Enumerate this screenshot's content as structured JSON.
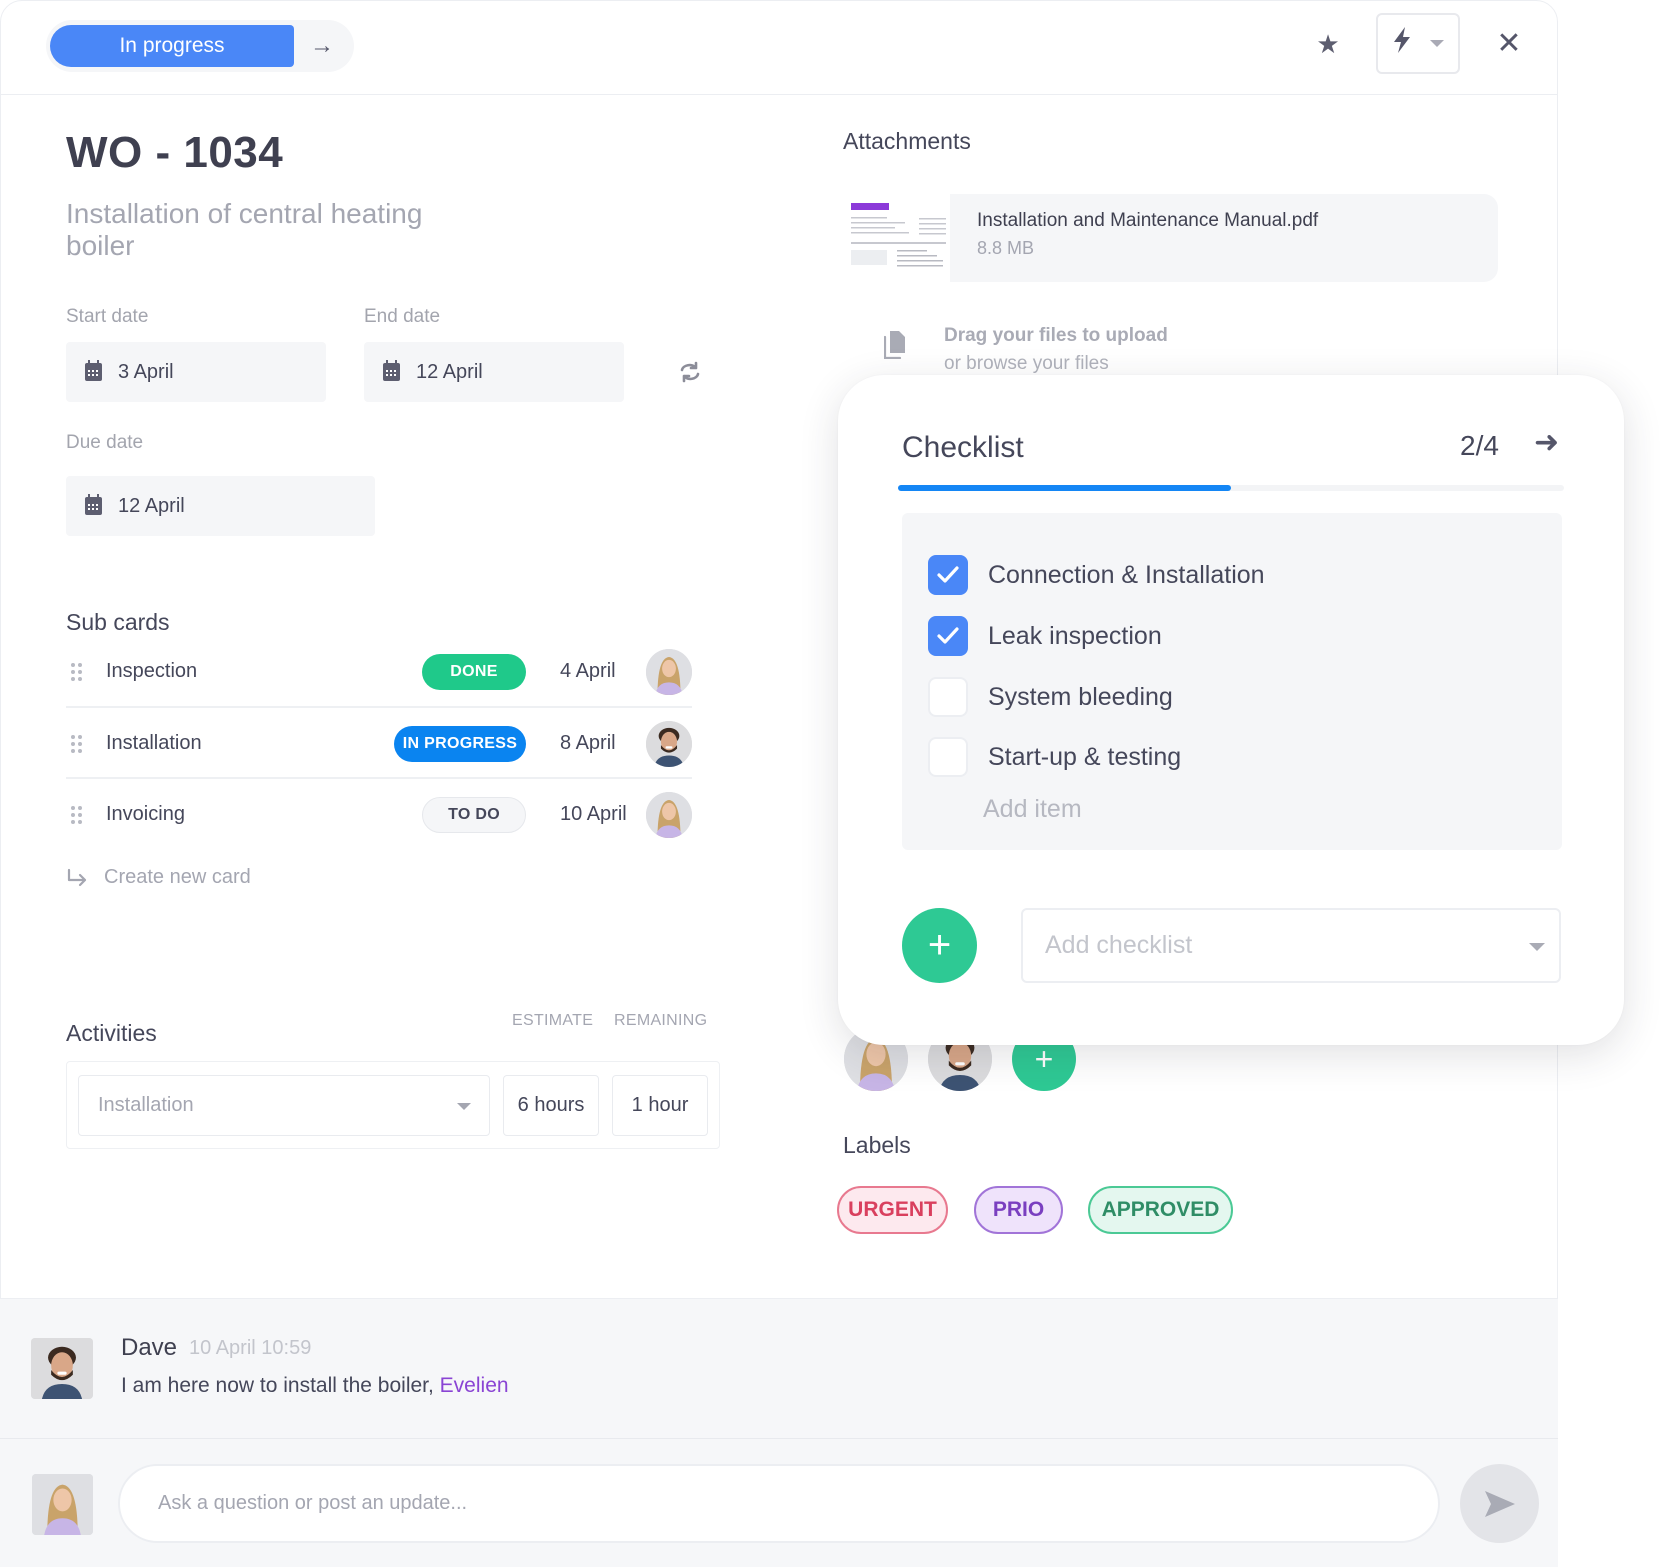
{
  "header": {
    "status_label": "In progress",
    "next_status_icon": "arrow-right",
    "favorite_icon": "star",
    "automation_icon": "lightning-bolt",
    "close_icon": "close"
  },
  "work_order": {
    "id": "WO - 1034",
    "description": "Installation of central heating boiler"
  },
  "dates": {
    "start_label": "Start date",
    "start_value": "3 April",
    "end_label": "End date",
    "end_value": "12 April",
    "due_label": "Due date",
    "due_value": "12 April"
  },
  "sub_cards": {
    "title": "Sub cards",
    "items": [
      {
        "name": "Inspection",
        "status": "DONE",
        "date": "4 April",
        "assignee": "woman"
      },
      {
        "name": "Installation",
        "status": "IN PROGRESS",
        "date": "8 April",
        "assignee": "man"
      },
      {
        "name": "Invoicing",
        "status": "TO DO",
        "date": "10 April",
        "assignee": "woman"
      }
    ],
    "create_label": "Create new card"
  },
  "activities": {
    "title": "Activities",
    "estimate_header": "ESTIMATE",
    "remaining_header": "REMAINING",
    "activity_value": "Installation",
    "estimate_value": "6 hours",
    "remaining_value": "1 hour"
  },
  "attachments": {
    "title": "Attachments",
    "files": [
      {
        "name": "Installation and Maintenance Manual.pdf",
        "size": "8.8 MB"
      }
    ],
    "upload_line1": "Drag your files to upload",
    "upload_line2": "or browse your files"
  },
  "checklist": {
    "title": "Checklist",
    "count": "2/4",
    "progress": 0.5,
    "items": [
      {
        "label": "Connection & Installation",
        "checked": true
      },
      {
        "label": "Leak inspection",
        "checked": true
      },
      {
        "label": "System bleeding",
        "checked": false
      },
      {
        "label": "Start-up & testing",
        "checked": false
      }
    ],
    "add_item_placeholder": "Add item",
    "add_checklist_placeholder": "Add checklist"
  },
  "members": {
    "avatars": [
      "woman",
      "man"
    ]
  },
  "labels": {
    "title": "Labels",
    "items": [
      {
        "text": "URGENT",
        "color": "#d9405e",
        "bg": "#fde9ee",
        "border": "#e8798f"
      },
      {
        "text": "PRIO",
        "color": "#7a3fc0",
        "bg": "#efe3fb",
        "border": "#a174d8"
      },
      {
        "text": "APPROVED",
        "color": "#2f8d66",
        "bg": "#e4f7ef",
        "border": "#4bc995"
      }
    ]
  },
  "comments": {
    "items": [
      {
        "author": "Dave",
        "time": "10 April 10:59",
        "text": "I am here now to install the boiler, ",
        "mention": "Evelien"
      }
    ],
    "reply_placeholder": "Ask a question or post an update..."
  },
  "colors": {
    "primary_blue": "#4a87f7",
    "progress_blue": "#1486f5",
    "green": "#2ec994",
    "done_badge": "#1fc98a",
    "in_progress_badge": "#0a84f0"
  }
}
